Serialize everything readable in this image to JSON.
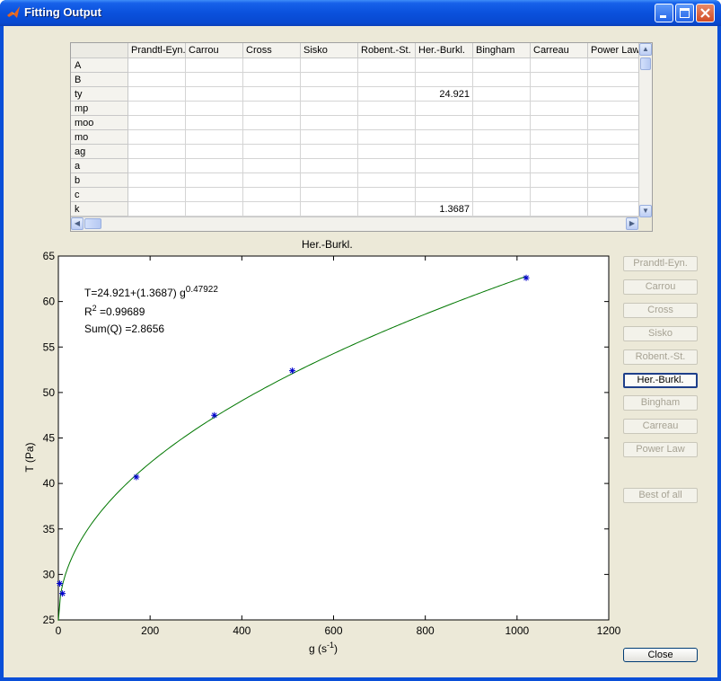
{
  "window": {
    "title": "Fitting Output"
  },
  "table": {
    "columns": [
      "Prandtl-Eyn.",
      "Carrou",
      "Cross",
      "Sisko",
      "Robent.-St.",
      "Her.-Burkl.",
      "Bingham",
      "Carreau",
      "Power Law"
    ],
    "rows": [
      {
        "label": "A",
        "cells": [
          "",
          "",
          "",
          "",
          "",
          "",
          "",
          "",
          ""
        ]
      },
      {
        "label": "B",
        "cells": [
          "",
          "",
          "",
          "",
          "",
          "",
          "",
          "",
          ""
        ]
      },
      {
        "label": "ty",
        "cells": [
          "",
          "",
          "",
          "",
          "",
          "24.921",
          "",
          "",
          ""
        ]
      },
      {
        "label": "mp",
        "cells": [
          "",
          "",
          "",
          "",
          "",
          "",
          "",
          "",
          ""
        ]
      },
      {
        "label": "moo",
        "cells": [
          "",
          "",
          "",
          "",
          "",
          "",
          "",
          "",
          ""
        ]
      },
      {
        "label": "mo",
        "cells": [
          "",
          "",
          "",
          "",
          "",
          "",
          "",
          "",
          ""
        ]
      },
      {
        "label": "ag",
        "cells": [
          "",
          "",
          "",
          "",
          "",
          "",
          "",
          "",
          ""
        ]
      },
      {
        "label": "a",
        "cells": [
          "",
          "",
          "",
          "",
          "",
          "",
          "",
          "",
          ""
        ]
      },
      {
        "label": "b",
        "cells": [
          "",
          "",
          "",
          "",
          "",
          "",
          "",
          "",
          ""
        ]
      },
      {
        "label": "c",
        "cells": [
          "",
          "",
          "",
          "",
          "",
          "",
          "",
          "",
          ""
        ]
      },
      {
        "label": "k",
        "cells": [
          "",
          "",
          "",
          "",
          "",
          "1.3687",
          "",
          "",
          ""
        ]
      }
    ]
  },
  "chart_data": {
    "type": "scatter",
    "title": "Her.-Burkl.",
    "xlabel": "g (s",
    "xlabel_sup": "-1",
    "xlabel_close": ")",
    "ylabel": "T (Pa)",
    "xlim": [
      0,
      1200
    ],
    "ylim": [
      25,
      65
    ],
    "xticks": [
      0,
      200,
      400,
      600,
      800,
      1000,
      1200
    ],
    "yticks": [
      25,
      30,
      35,
      40,
      45,
      50,
      55,
      60,
      65
    ],
    "points": [
      {
        "x": 3,
        "y": 29.0
      },
      {
        "x": 9,
        "y": 27.9
      },
      {
        "x": 170,
        "y": 40.7
      },
      {
        "x": 340,
        "y": 47.5
      },
      {
        "x": 510,
        "y": 52.4
      },
      {
        "x": 1020,
        "y": 62.6
      }
    ],
    "fit": {
      "ty": 24.921,
      "k": 1.3687,
      "n": 0.47922
    },
    "annotations": {
      "equation_main": "T=24.921+(1.3687) g",
      "equation_exp": "0.47922",
      "r2_label": "R",
      "r2_sup": "2",
      "r2_value": " =0.99689",
      "sum_q": "Sum(Q) =2.8656"
    },
    "marker_color": "#0000cc",
    "fit_color": "#007700"
  },
  "buttons": {
    "models": [
      "Prandtl-Eyn.",
      "Carrou",
      "Cross",
      "Sisko",
      "Robent.-St.",
      "Her.-Burkl.",
      "Bingham",
      "Carreau",
      "Power Law"
    ],
    "active_index": 5,
    "best_of_all": "Best of all",
    "close": "Close"
  }
}
